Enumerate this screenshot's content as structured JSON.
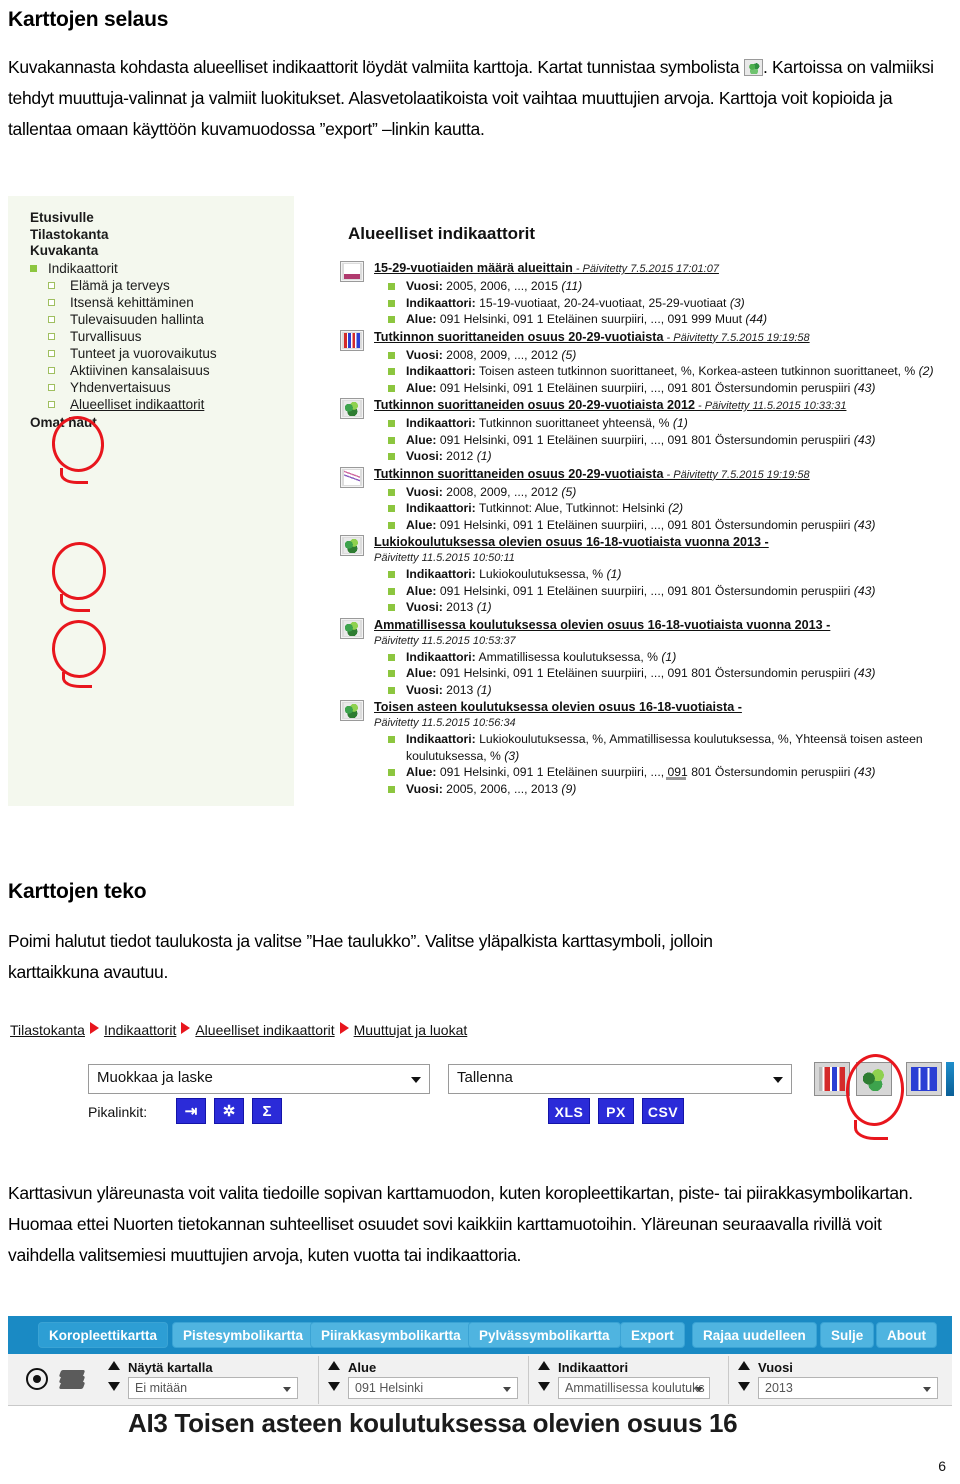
{
  "document": {
    "heading1": "Karttojen selaus",
    "para1_a": "Kuvakannasta kohdasta alueelliset indikaattorit löydät valmiita karttoja. Kartat tunnistaa symbolista",
    "para1_b": ". Kartoissa on valmiiksi tehdyt muuttuja-valinnat ja valmiit luokitukset. Alasvetolaatikoista voit vaihtaa muuttujien arvoja. Karttoja voit kopioida ja tallentaa omaan käyttöön kuvamuodossa ”export” –linkin kautta.",
    "heading2": "Karttojen teko",
    "para2": "Poimi halutut tiedot taulukosta ja valitse ”Hae taulukko”. Valitse yläpalkista karttasymboli, jolloin karttaikkuna avautuu.",
    "para3": "Karttasivun yläreunasta voit valita tiedoille sopivan karttamuodon, kuten koropleettikartan, piste- tai piirakkasymbolikartan. Huomaa ettei Nuorten tietokannan suhteelliset osuudet sovi kaikkiin karttamuotoihin. Yläreunan seuraavalla rivillä voit vaihdella valitsemiesi muuttujien arvoja, kuten vuotta tai indikaattoria.",
    "page_number": "6"
  },
  "sidebar": {
    "top_links": [
      "Etusivulle",
      "Tilastokanta",
      "Kuvakanta"
    ],
    "group": "Indikaattorit",
    "items": [
      {
        "label": "Elämä ja terveys",
        "active": false
      },
      {
        "label": "Itsensä kehittäminen",
        "active": false
      },
      {
        "label": "Tulevaisuuden hallinta",
        "active": false
      },
      {
        "label": "Turvallisuus",
        "active": false
      },
      {
        "label": "Tunteet ja vuorovaikutus",
        "active": false
      },
      {
        "label": "Aktiivinen kansalaisuus",
        "active": false
      },
      {
        "label": "Yhdenvertaisuus",
        "active": false
      },
      {
        "label": "Alueelliset indikaattorit",
        "active": true
      }
    ],
    "bottom_link": "Omat haut"
  },
  "panel": {
    "title": "Alueelliset indikaattorit",
    "indicators": [
      {
        "icon": "area-chart-icon",
        "icon_class": "ico-area",
        "title": "15-29-vuotiaiden määrä alueittain",
        "updated": " - Päivitetty 7.5.2015 17:01:07",
        "date_inline": true,
        "dims": [
          {
            "label": "Vuosi:",
            "value": " 2005, 2006, ..., 2015",
            "count": "(11)"
          },
          {
            "label": "Indikaattori:",
            "value": " 15-19-vuotiaat, 20-24-vuotiaat, 25-29-vuotiaat",
            "count": "(3)"
          },
          {
            "label": "Alue:",
            "value": " 091 Helsinki, 091 1 Eteläinen suurpiiri, ..., 091 999 Muut",
            "count": "(44)"
          }
        ]
      },
      {
        "icon": "bar-chart-icon",
        "icon_class": "ico-bar",
        "title": "Tutkinnon suorittaneiden osuus 20-29-vuotiaista",
        "updated": " - Päivitetty 7.5.2015 19:19:58",
        "date_inline": true,
        "dims": [
          {
            "label": "Vuosi:",
            "value": " 2008, 2009, ..., 2012",
            "count": "(5)"
          },
          {
            "label": "Indikaattori:",
            "value": " Toisen asteen tutkinnon suorittaneet, %, Korkea-asteen tutkinnon suorittaneet, %",
            "count": "(2)"
          },
          {
            "label": "Alue:",
            "value": " 091 Helsinki, 091 1 Eteläinen suurpiiri, ..., 091 801 Östersundomin peruspiiri",
            "count": "(43)"
          }
        ]
      },
      {
        "icon": "map-icon",
        "icon_class": "ico-map",
        "title": "Tutkinnon suorittaneiden osuus 20-29-vuotiaista 2012",
        "updated": " - Päivitetty 11.5.2015 10:33:31",
        "date_inline": true,
        "circled": true,
        "dims": [
          {
            "label": "Indikaattori:",
            "value": " Tutkinnon suorittaneet yhteensä, %",
            "count": "(1)"
          },
          {
            "label": "Alue:",
            "value": " 091 Helsinki, 091 1 Eteläinen suurpiiri, ..., 091 801 Östersundomin peruspiiri",
            "count": "(43)"
          },
          {
            "label": "Vuosi:",
            "value": " 2012",
            "count": "(1)"
          }
        ]
      },
      {
        "icon": "line-chart-icon",
        "icon_class": "ico-line",
        "title": "Tutkinnon suorittaneiden osuus 20-29-vuotiaista",
        "updated": " - Päivitetty 7.5.2015 19:19:58",
        "date_inline": true,
        "dims": [
          {
            "label": "Vuosi:",
            "value": " 2008, 2009, ..., 2012",
            "count": "(5)"
          },
          {
            "label": "Indikaattori:",
            "value": " Tutkinnot: Alue, Tutkinnot: Helsinki",
            "count": "(2)"
          },
          {
            "label": "Alue:",
            "value": " 091 Helsinki, 091 1 Eteläinen suurpiiri, ..., 091 801 Östersundomin peruspiiri",
            "count": "(43)"
          }
        ]
      },
      {
        "icon": "map-icon",
        "icon_class": "ico-map",
        "title": "Lukiokoulutuksessa olevien osuus 16-18-vuotiaista vuonna 2013 -",
        "updated": "Päivitetty 11.5.2015 10:50:11",
        "date_inline": false,
        "circled": true,
        "dims": [
          {
            "label": "Indikaattori:",
            "value": " Lukiokoulutuksessa, %",
            "count": "(1)"
          },
          {
            "label": "Alue:",
            "value": " 091 Helsinki, 091 1 Eteläinen suurpiiri, ..., 091 801 Östersundomin peruspiiri",
            "count": "(43)"
          },
          {
            "label": "Vuosi:",
            "value": " 2013",
            "count": "(1)"
          }
        ]
      },
      {
        "icon": "map-icon",
        "icon_class": "ico-map",
        "title": "Ammatillisessa koulutuksessa olevien osuus 16-18-vuotiaista vuonna 2013 -",
        "updated": "Päivitetty 11.5.2015 10:53:37",
        "date_inline": false,
        "circled": true,
        "dims": [
          {
            "label": "Indikaattori:",
            "value": " Ammatillisessa koulutuksessa, %",
            "count": "(1)"
          },
          {
            "label": "Alue:",
            "value": " 091 Helsinki, 091 1 Eteläinen suurpiiri, ..., 091 801 Östersundomin peruspiiri",
            "count": "(43)"
          },
          {
            "label": "Vuosi:",
            "value": " 2013",
            "count": "(1)"
          }
        ]
      },
      {
        "icon": "map-icon",
        "icon_class": "ico-map",
        "title": "Toisen asteen koulutuksessa olevien osuus 16-18-vuotiaista -",
        "updated": "Päivitetty 11.5.2015 10:56:34",
        "date_inline": false,
        "dims": [
          {
            "label": "Indikaattori:",
            "value": " Lukiokoulutuksessa, %, Ammatillisessa koulutuksessa, %, Yhteensä toisen asteen koulutuksessa, %",
            "count": "(3)"
          },
          {
            "label": "Alue:",
            "value": " 091 Helsinki, 091 1 Eteläinen suurpiiri, ..., 091 801 Östersundomin peruspiiri",
            "count": "(43)"
          },
          {
            "label": "Vuosi:",
            "value": " 2005, 2006, ..., 2013",
            "count": "(9)"
          }
        ]
      }
    ]
  },
  "breadcrumb": {
    "items": [
      "Tilastokanta",
      "Indikaattorit",
      "Alueelliset indikaattorit",
      "Muuttujat ja luokat"
    ]
  },
  "toolbar": {
    "edit_select_value": "Muokkaa ja laske",
    "save_select_value": "Tallenna",
    "quicklinks_label": "Pikalinkit:",
    "quicklinks": [
      "⇥",
      "✲",
      "Σ"
    ],
    "format_buttons": [
      "XLS",
      "PX",
      "CSV"
    ],
    "tool_icons": [
      "bar-chart-icon",
      "map-icon",
      "table-icon"
    ]
  },
  "map_app": {
    "buttons": [
      {
        "label": "Koropleettikartta",
        "active": true
      },
      {
        "label": "Pistesymbolikartta",
        "active": false
      },
      {
        "label": "Piirakkasymbolikartta",
        "active": false
      },
      {
        "label": "Pylvässymbolikartta",
        "active": false
      },
      {
        "label": "Export",
        "active": false
      },
      {
        "label": "Rajaa uudelleen",
        "active": false
      },
      {
        "label": "Sulje",
        "active": false
      },
      {
        "label": "About",
        "active": false
      }
    ],
    "controls": [
      {
        "label": "Näytä kartalla",
        "value": "Ei mitään"
      },
      {
        "label": "Alue",
        "value": "091 Helsinki"
      },
      {
        "label": "Indikaattori",
        "value": "Ammatillisessa koulutuks"
      },
      {
        "label": "Vuosi",
        "value": "2013"
      }
    ],
    "map_title": "AI3  Toisen asteen koulutuksessa olevien osuus 16"
  },
  "colors": {
    "accent_green": "#8cc63f",
    "annotation_red": "#e8161d",
    "map_blue": "#1a8ac4",
    "button_blue": "#2b2bd8"
  }
}
